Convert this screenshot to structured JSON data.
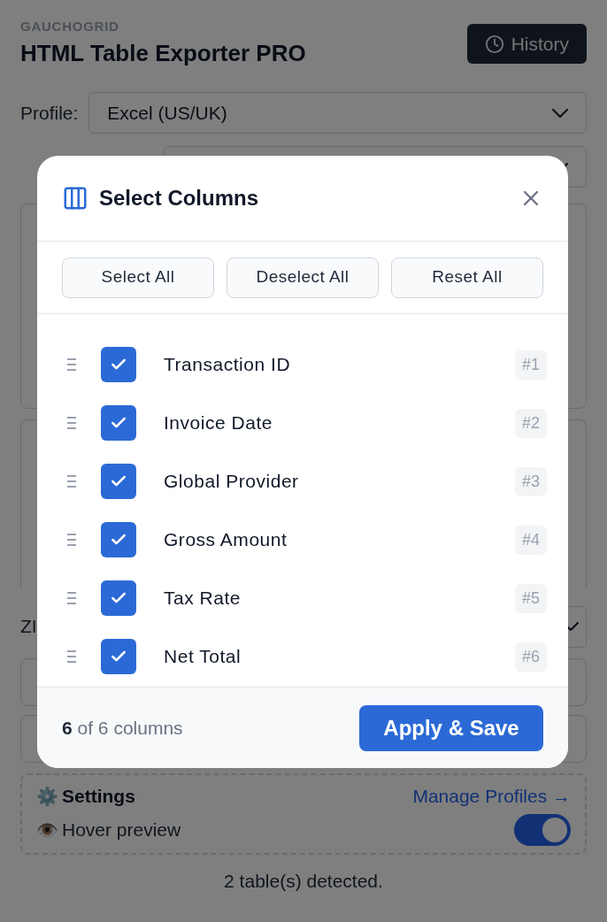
{
  "page": {
    "brand": "GAUCHOGRID",
    "title": "HTML Table Exporter PRO",
    "history_button": "History",
    "profile": {
      "label": "Profile:",
      "value": "Excel (US/UK)"
    },
    "zip_label": "ZI",
    "settings": {
      "icon": "⚙️",
      "title": "Settings",
      "link": "Manage Profiles →",
      "hover_icon": "👁️",
      "hover_label": "Hover preview",
      "hover_on": true
    },
    "status": "2 table(s) detected."
  },
  "dialog": {
    "title": "Select Columns",
    "actions": [
      "Select All",
      "Deselect All",
      "Reset All"
    ],
    "columns": [
      {
        "name": "Transaction ID",
        "checked": true,
        "index": "#1"
      },
      {
        "name": "Invoice Date",
        "checked": true,
        "index": "#2"
      },
      {
        "name": "Global Provider",
        "checked": true,
        "index": "#3"
      },
      {
        "name": "Gross Amount",
        "checked": true,
        "index": "#4"
      },
      {
        "name": "Tax Rate",
        "checked": true,
        "index": "#5"
      },
      {
        "name": "Net Total",
        "checked": true,
        "index": "#6"
      }
    ],
    "summary": "**6** of 6 columns",
    "apply_button": "Apply & Save"
  }
}
